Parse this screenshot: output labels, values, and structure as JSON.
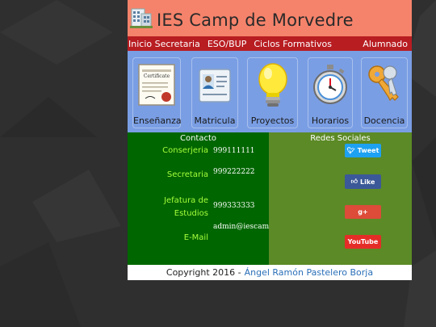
{
  "header": {
    "title": "IES Camp de Morvedre",
    "logo_icon": "building-icon"
  },
  "nav": {
    "items": [
      "Inicio Secretaria",
      "ESO/BUP",
      "Ciclos Formativos",
      "Alumnado"
    ]
  },
  "tiles": [
    {
      "label": "Enseñanza",
      "icon": "certificate-icon",
      "text": "Certificate"
    },
    {
      "label": "Matricula",
      "icon": "id-card-icon"
    },
    {
      "label": "Proyectos",
      "icon": "lightbulb-icon"
    },
    {
      "label": "Horarios",
      "icon": "stopwatch-icon"
    },
    {
      "label": "Docencia",
      "icon": "keys-icon"
    }
  ],
  "contacto": {
    "title": "Contacto",
    "entries": [
      {
        "label": "Conserjeria",
        "value": "999111111"
      },
      {
        "label": "Secretaria",
        "value": "999222222"
      },
      {
        "label": "Jefatura de Estudios",
        "value": "999333333"
      },
      {
        "label": "E-Mail",
        "value": "admin@iescamp.es"
      }
    ]
  },
  "redes": {
    "title": "Redes Sociales",
    "buttons": [
      {
        "name": "twitter",
        "label": "Tweet",
        "color": "#1da1f2"
      },
      {
        "name": "facebook",
        "label": "Like",
        "color": "#3b5998"
      },
      {
        "name": "googleplus",
        "label": "g+",
        "color": "#dd4b39"
      },
      {
        "name": "youtube",
        "label": "YouTube",
        "color": "#e52d27"
      }
    ]
  },
  "footer": {
    "copyright": "Copyright 2016 -",
    "author": "Ángel Ramón Pastelero Borja"
  }
}
